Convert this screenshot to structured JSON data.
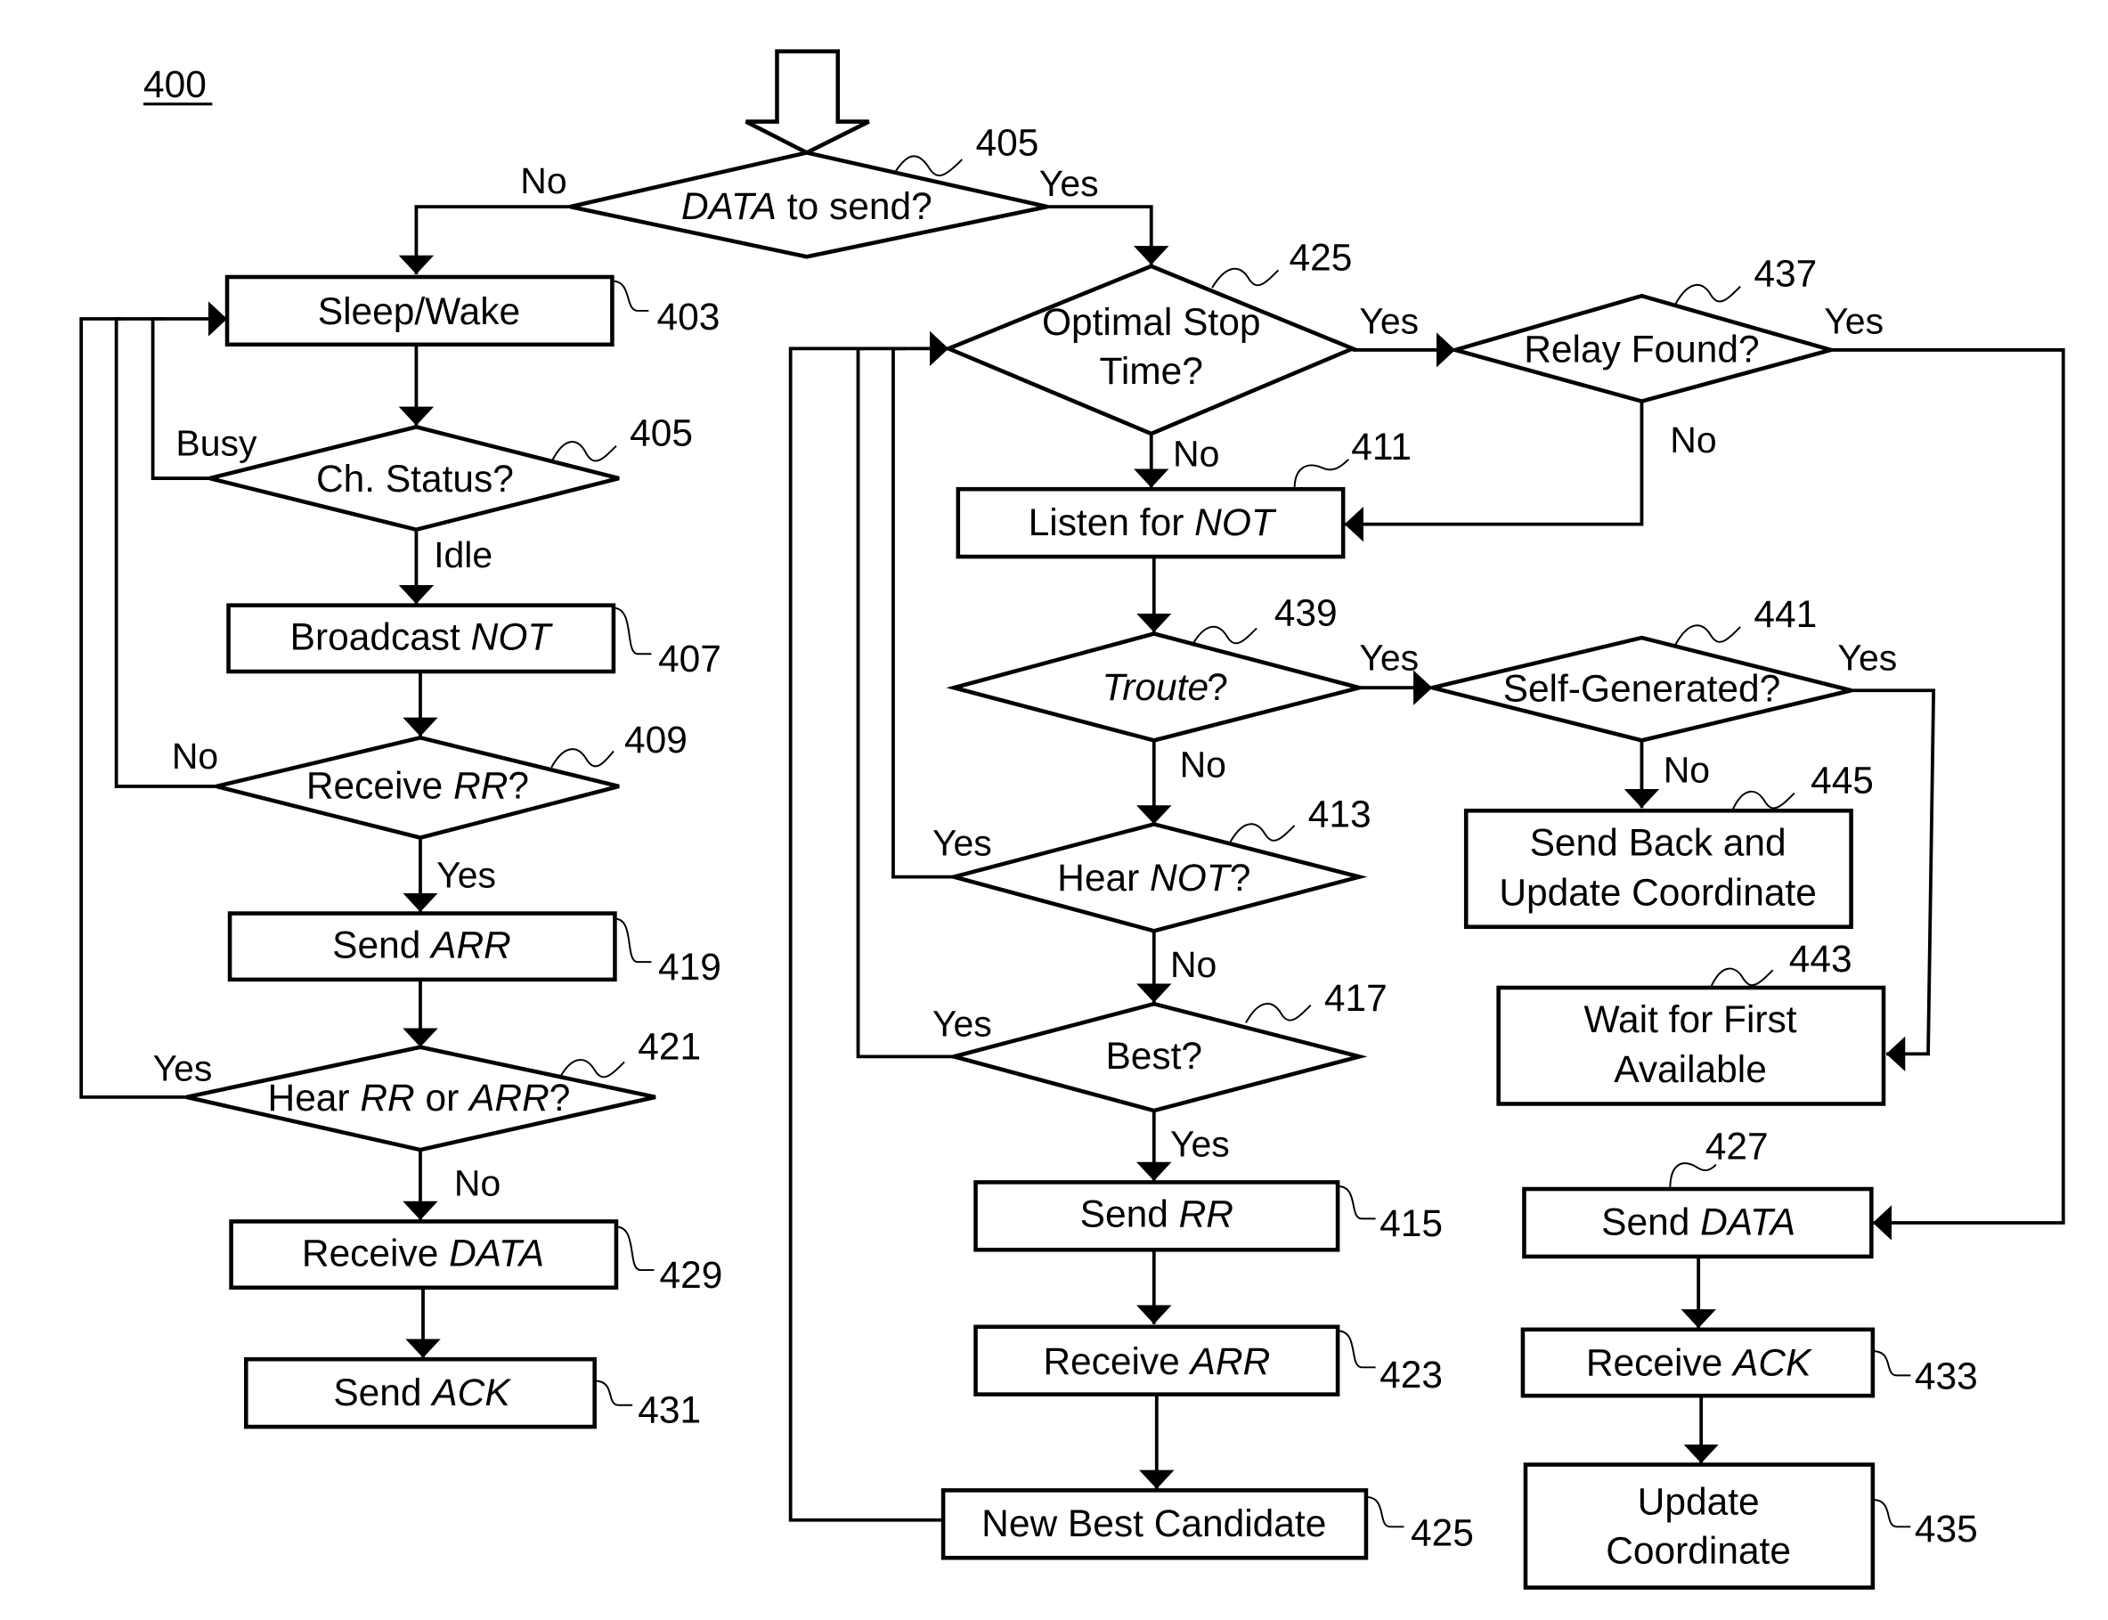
{
  "figure_label": "400",
  "nodes": {
    "n405a": {
      "ref": "405",
      "pre": "",
      "em": "DATA",
      "post": " to send?"
    },
    "n403": {
      "ref": "403",
      "pre": "Sleep/Wake",
      "em": "",
      "post": ""
    },
    "n405b": {
      "ref": "405",
      "pre": "Ch. Status?",
      "em": "",
      "post": ""
    },
    "n407": {
      "ref": "407",
      "pre": "Broadcast ",
      "em": "NOT",
      "post": ""
    },
    "n409": {
      "ref": "409",
      "pre": "Receive ",
      "em": "RR",
      "post": "?"
    },
    "n419": {
      "ref": "419",
      "pre": "Send ",
      "em": "ARR",
      "post": ""
    },
    "n421": {
      "ref": "421",
      "pre": "Hear ",
      "em": "RR",
      "mid": " or ",
      "em2": "ARR",
      "post": "?"
    },
    "n429": {
      "ref": "429",
      "pre": "Receive ",
      "em": "DATA",
      "post": ""
    },
    "n431": {
      "ref": "431",
      "pre": "Send ",
      "em": "ACK",
      "post": ""
    },
    "n425a": {
      "ref": "425",
      "line1": "Optimal Stop",
      "line2": "Time?"
    },
    "n437": {
      "ref": "437",
      "pre": "Relay Found?",
      "em": "",
      "post": ""
    },
    "n411": {
      "ref": "411",
      "pre": "Listen for ",
      "em": "NOT",
      "post": ""
    },
    "n439": {
      "ref": "439",
      "pre": "",
      "em": "Troute",
      "post": "?"
    },
    "n441": {
      "ref": "441",
      "pre": "Self-Generated?",
      "em": "",
      "post": ""
    },
    "n445": {
      "ref": "445",
      "line1": "Send Back and",
      "line2": "Update Coordinate"
    },
    "n413": {
      "ref": "413",
      "pre": "Hear ",
      "em": "NOT",
      "post": "?"
    },
    "n443": {
      "ref": "443",
      "line1": "Wait for First",
      "line2": "Available"
    },
    "n417": {
      "ref": "417",
      "pre": "Best?",
      "em": "",
      "post": ""
    },
    "n415": {
      "ref": "415",
      "pre": "Send ",
      "em": "RR",
      "post": ""
    },
    "n427": {
      "ref": "427",
      "pre": "Send ",
      "em": "DATA",
      "post": ""
    },
    "n423": {
      "ref": "423",
      "pre": "Receive ",
      "em": "ARR",
      "post": ""
    },
    "n433": {
      "ref": "433",
      "pre": "Receive ",
      "em": "ACK",
      "post": ""
    },
    "n425b": {
      "ref": "425",
      "pre": "New Best Candidate",
      "em": "",
      "post": ""
    },
    "n435": {
      "ref": "435",
      "line1": "Update",
      "line2": "Coordinate"
    }
  },
  "edge_labels": {
    "l1": "No",
    "l2": "Yes",
    "l3": "Busy",
    "l4": "Idle",
    "l5": "No",
    "l6": "Yes",
    "l7": "Yes",
    "l8": "No",
    "l9": "Yes",
    "l10": "No",
    "l11": "Yes",
    "l12": "No",
    "l13": "Yes",
    "l14": "Yes",
    "l15": "No",
    "l16": "No",
    "l17": "Yes",
    "l18": "No",
    "l19": "Yes"
  }
}
